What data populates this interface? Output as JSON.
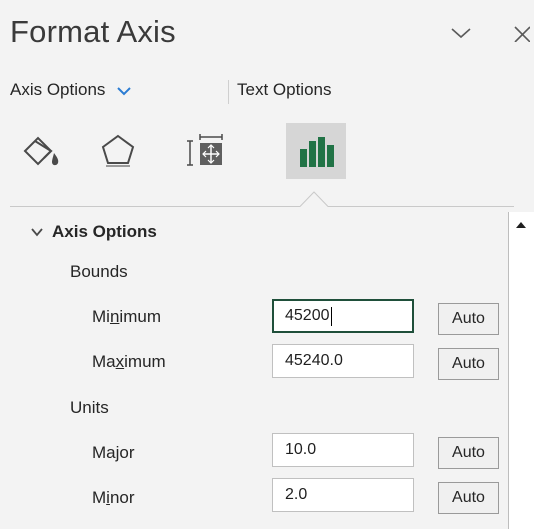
{
  "pane": {
    "title": "Format Axis"
  },
  "tabs": [
    {
      "label": "Axis Options",
      "active": true
    },
    {
      "label": "Text Options",
      "active": false
    }
  ],
  "icon_tabs": [
    {
      "icon": "fill-line-icon",
      "selected": false
    },
    {
      "icon": "effects-icon",
      "selected": false
    },
    {
      "icon": "size-properties-icon",
      "selected": false
    },
    {
      "icon": "axis-options-chart-icon",
      "selected": true
    }
  ],
  "section": {
    "title": "Axis Options",
    "bounds": {
      "label": "Bounds",
      "minimum": {
        "label_pre": "Mi",
        "label_u": "n",
        "label_post": "imum",
        "value": "45200",
        "auto": "Auto"
      },
      "maximum": {
        "label_pre": "Ma",
        "label_u": "x",
        "label_post": "imum",
        "value": "45240.0",
        "auto": "Auto"
      }
    },
    "units": {
      "label": "Units",
      "major": {
        "label_pre": "Ma",
        "label_u": "j",
        "label_post": "or",
        "value": "10.0",
        "auto": "Auto"
      },
      "minor": {
        "label_pre": "M",
        "label_u": "i",
        "label_post": "nor",
        "value": "2.0",
        "auto": "Auto"
      }
    }
  },
  "colors": {
    "accent_blue": "#2b7cd3",
    "chart_green": "#217346",
    "focus_border": "#1f4f3a"
  }
}
